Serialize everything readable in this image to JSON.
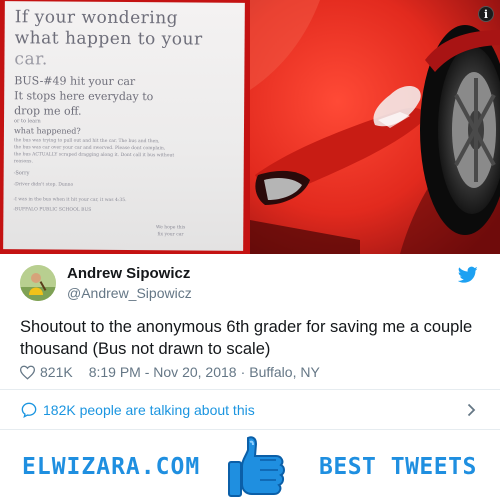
{
  "note": {
    "big_lines": [
      "If your wondering",
      "what happen to your",
      "car."
    ],
    "mid_lines": [
      "BUS-#49 hit your car",
      "It stops here everyday to",
      "drop me off."
    ],
    "small_lines": [
      "or to learn",
      "what happened?",
      "the bus was trying to pull out and hit the car. The bus and then,",
      "the bus was car over your car and swerved. Please dont complain,",
      "the bus ACTUALLY scraped dragging along it. Dont call it bus without",
      "reasons.",
      "-Sorry",
      "-Driver didn't stop. Dunno",
      "-I was in the bus when it hit your car, it was 4:35.",
      "-BUFFALO PUBLIC SCHOOL BUS"
    ],
    "sign_lines": [
      "We hope this",
      "fix your car"
    ]
  },
  "info_badge": "i",
  "tweet": {
    "name": "Andrew Sipowicz",
    "handle": "@Andrew_Sipowicz",
    "text": "Shoutout to the anonymous 6th grader for saving me a couple thousand (Bus not drawn to scale)",
    "likes": "821K",
    "time": "8:19 PM - Nov 20, 2018",
    "separator": "·",
    "location": "Buffalo, NY"
  },
  "talk": {
    "text": "182K people are talking about this"
  },
  "footer": {
    "brand_left": "ELWIZARA.COM",
    "brand_right": "BEST TWEETS"
  },
  "colors": {
    "twitter_blue": "#1da1f2",
    "link_blue": "#1b95e0",
    "brand_blue": "#1f8fe0",
    "car_red": "#e22a1e"
  }
}
